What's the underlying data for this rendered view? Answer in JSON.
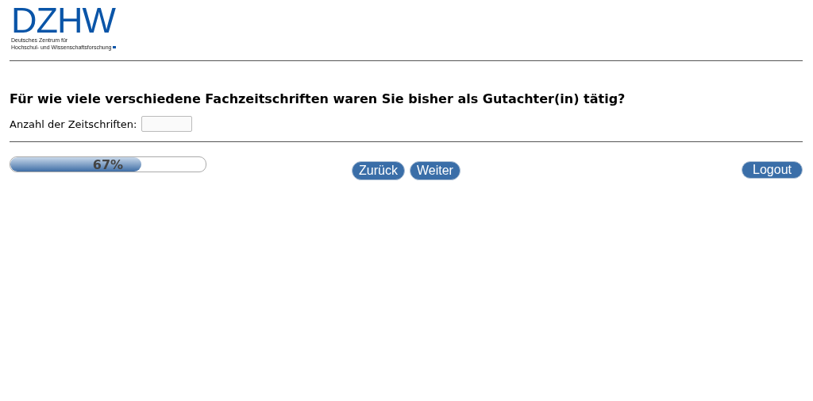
{
  "logo": {
    "name": "DZHW",
    "subtitle_lines": [
      "Deutsches Zentrum für",
      "Hochschul- und Wissenschaftsforschung"
    ]
  },
  "question": "Für wie viele verschiedene Fachzeitschriften waren Sie bisher als Gutachter(in) tätig?",
  "field": {
    "label": "Anzahl der Zeitschriften:"
  },
  "progress": {
    "level": 0.67,
    "reading": "67%"
  },
  "buttons": [
    "Zurück",
    "Weiter"
  ],
  "logout": "Logout"
}
